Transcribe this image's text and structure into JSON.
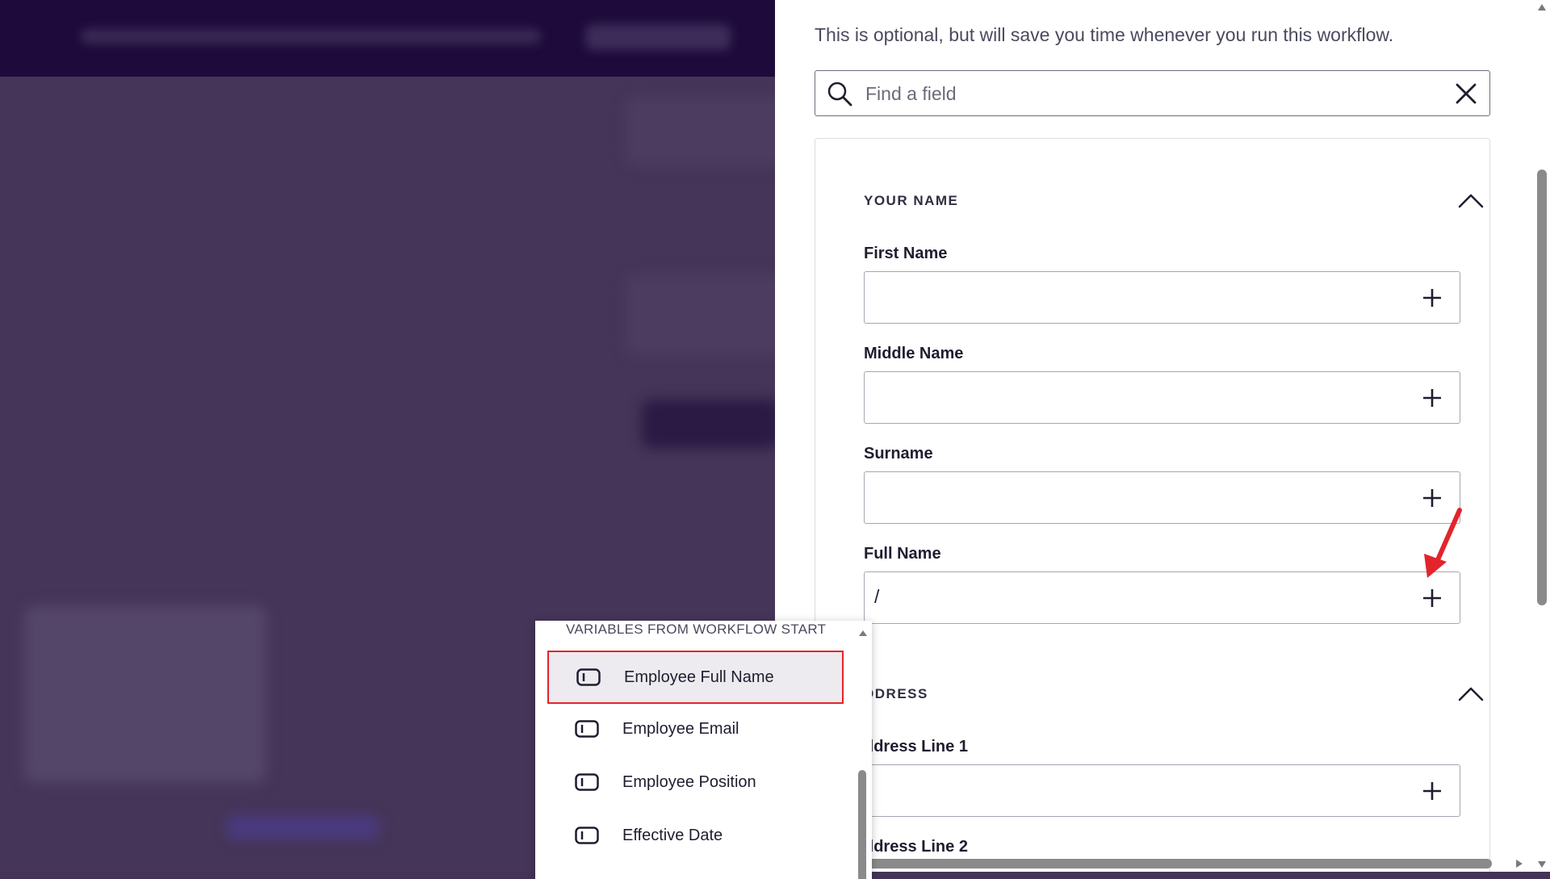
{
  "panel": {
    "hint": "This is optional, but will save you time whenever you run this workflow.",
    "search": {
      "placeholder": "Find a field"
    },
    "sections": [
      {
        "title": "YOUR NAME",
        "fields": [
          {
            "label": "First Name",
            "value": ""
          },
          {
            "label": "Middle Name",
            "value": ""
          },
          {
            "label": "Surname",
            "value": ""
          },
          {
            "label": "Full Name",
            "value": "/"
          }
        ]
      },
      {
        "title": "DDRESS",
        "fields": [
          {
            "label": "ddress Line 1",
            "value": ""
          },
          {
            "label": "ddress Line 2",
            "value": ""
          }
        ]
      }
    ]
  },
  "dropdown": {
    "header": "VARIABLES FROM WORKFLOW START",
    "items": [
      {
        "label": "Employee Full Name",
        "selected": true
      },
      {
        "label": "Employee Email"
      },
      {
        "label": "Employee Position"
      },
      {
        "label": "Effective Date"
      }
    ]
  },
  "icons": {
    "search": "search-icon",
    "clear": "close-icon",
    "collapse": "chevron-up-icon",
    "add": "plus-icon",
    "variable": "variable-icon"
  },
  "colors": {
    "overlay": "#453558",
    "header": "#1e0b3b",
    "highlight": "#e3242b",
    "annotation_arrow": "#e3242b"
  }
}
